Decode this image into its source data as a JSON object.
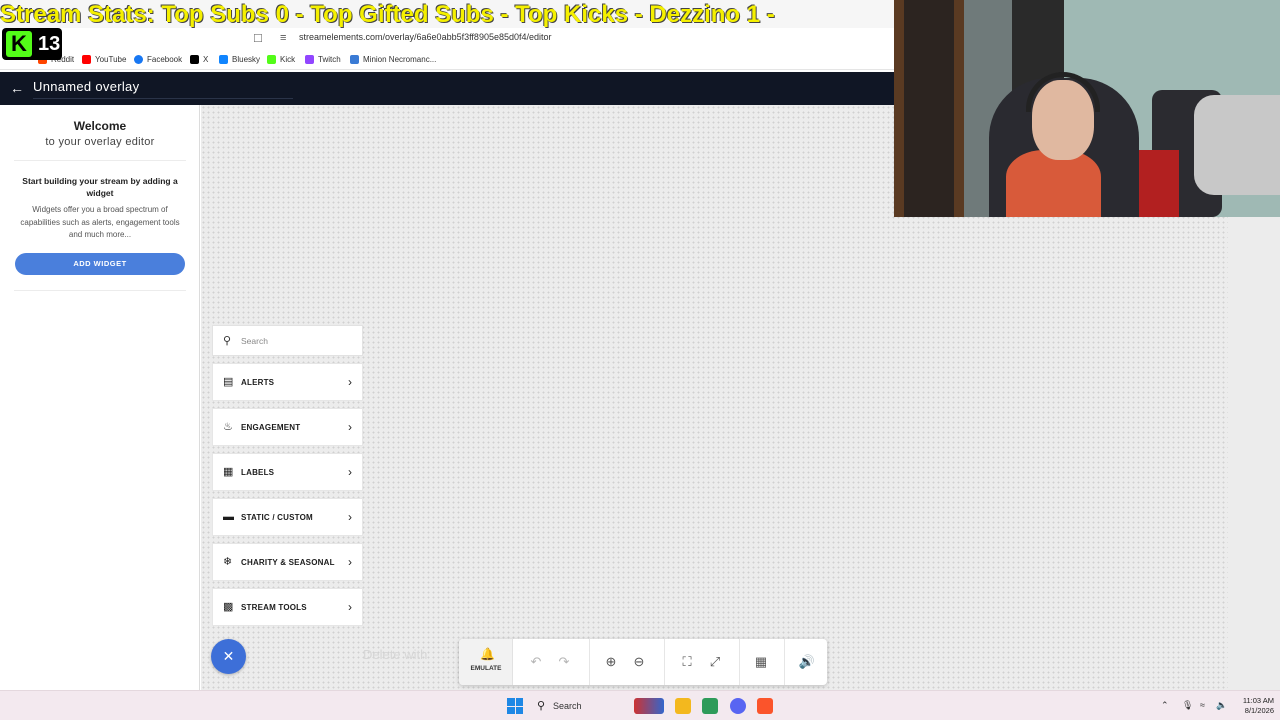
{
  "stream_overlay": {
    "title": "Stream Stats: Top Subs 0 - Top Gifted Subs - Top Kicks - Dezzino 1 -",
    "kick_count": "13"
  },
  "browser": {
    "url": "streamelements.com/overlay/6a6e0abb5f3ff8905e85d0f4/editor",
    "bookmarks": [
      "Reddit",
      "YouTube",
      "Facebook",
      "X",
      "Bluesky",
      "Kick",
      "Twitch",
      "Minion Necromanc..."
    ]
  },
  "header": {
    "overlay_name": "Unnamed overlay"
  },
  "sidebar": {
    "welcome_title": "Welcome",
    "welcome_sub": "to your overlay editor",
    "start_text": "Start building your stream by adding a widget",
    "desc_text": "Widgets offer you a broad spectrum of capabilities such as alerts, engagement tools and much more...",
    "add_widget": "ADD WIDGET"
  },
  "widget_menu": {
    "search_placeholder": "Search",
    "categories": [
      {
        "label": "ALERTS",
        "icon": "alerts-icon"
      },
      {
        "label": "ENGAGEMENT",
        "icon": "flame-icon"
      },
      {
        "label": "LABELS",
        "icon": "labels-icon"
      },
      {
        "label": "STATIC / CUSTOM",
        "icon": "monitor-icon"
      },
      {
        "label": "CHARITY & SEASONAL",
        "icon": "snowflake-icon"
      },
      {
        "label": "STREAM TOOLS",
        "icon": "dashboard-icon"
      }
    ]
  },
  "canvas": {
    "delete_hint": "Delete with"
  },
  "toolbar": {
    "emulate": "EMULATE"
  },
  "taskbar": {
    "search": "Search",
    "time": "11:03 AM",
    "date": "8/1/2026"
  }
}
